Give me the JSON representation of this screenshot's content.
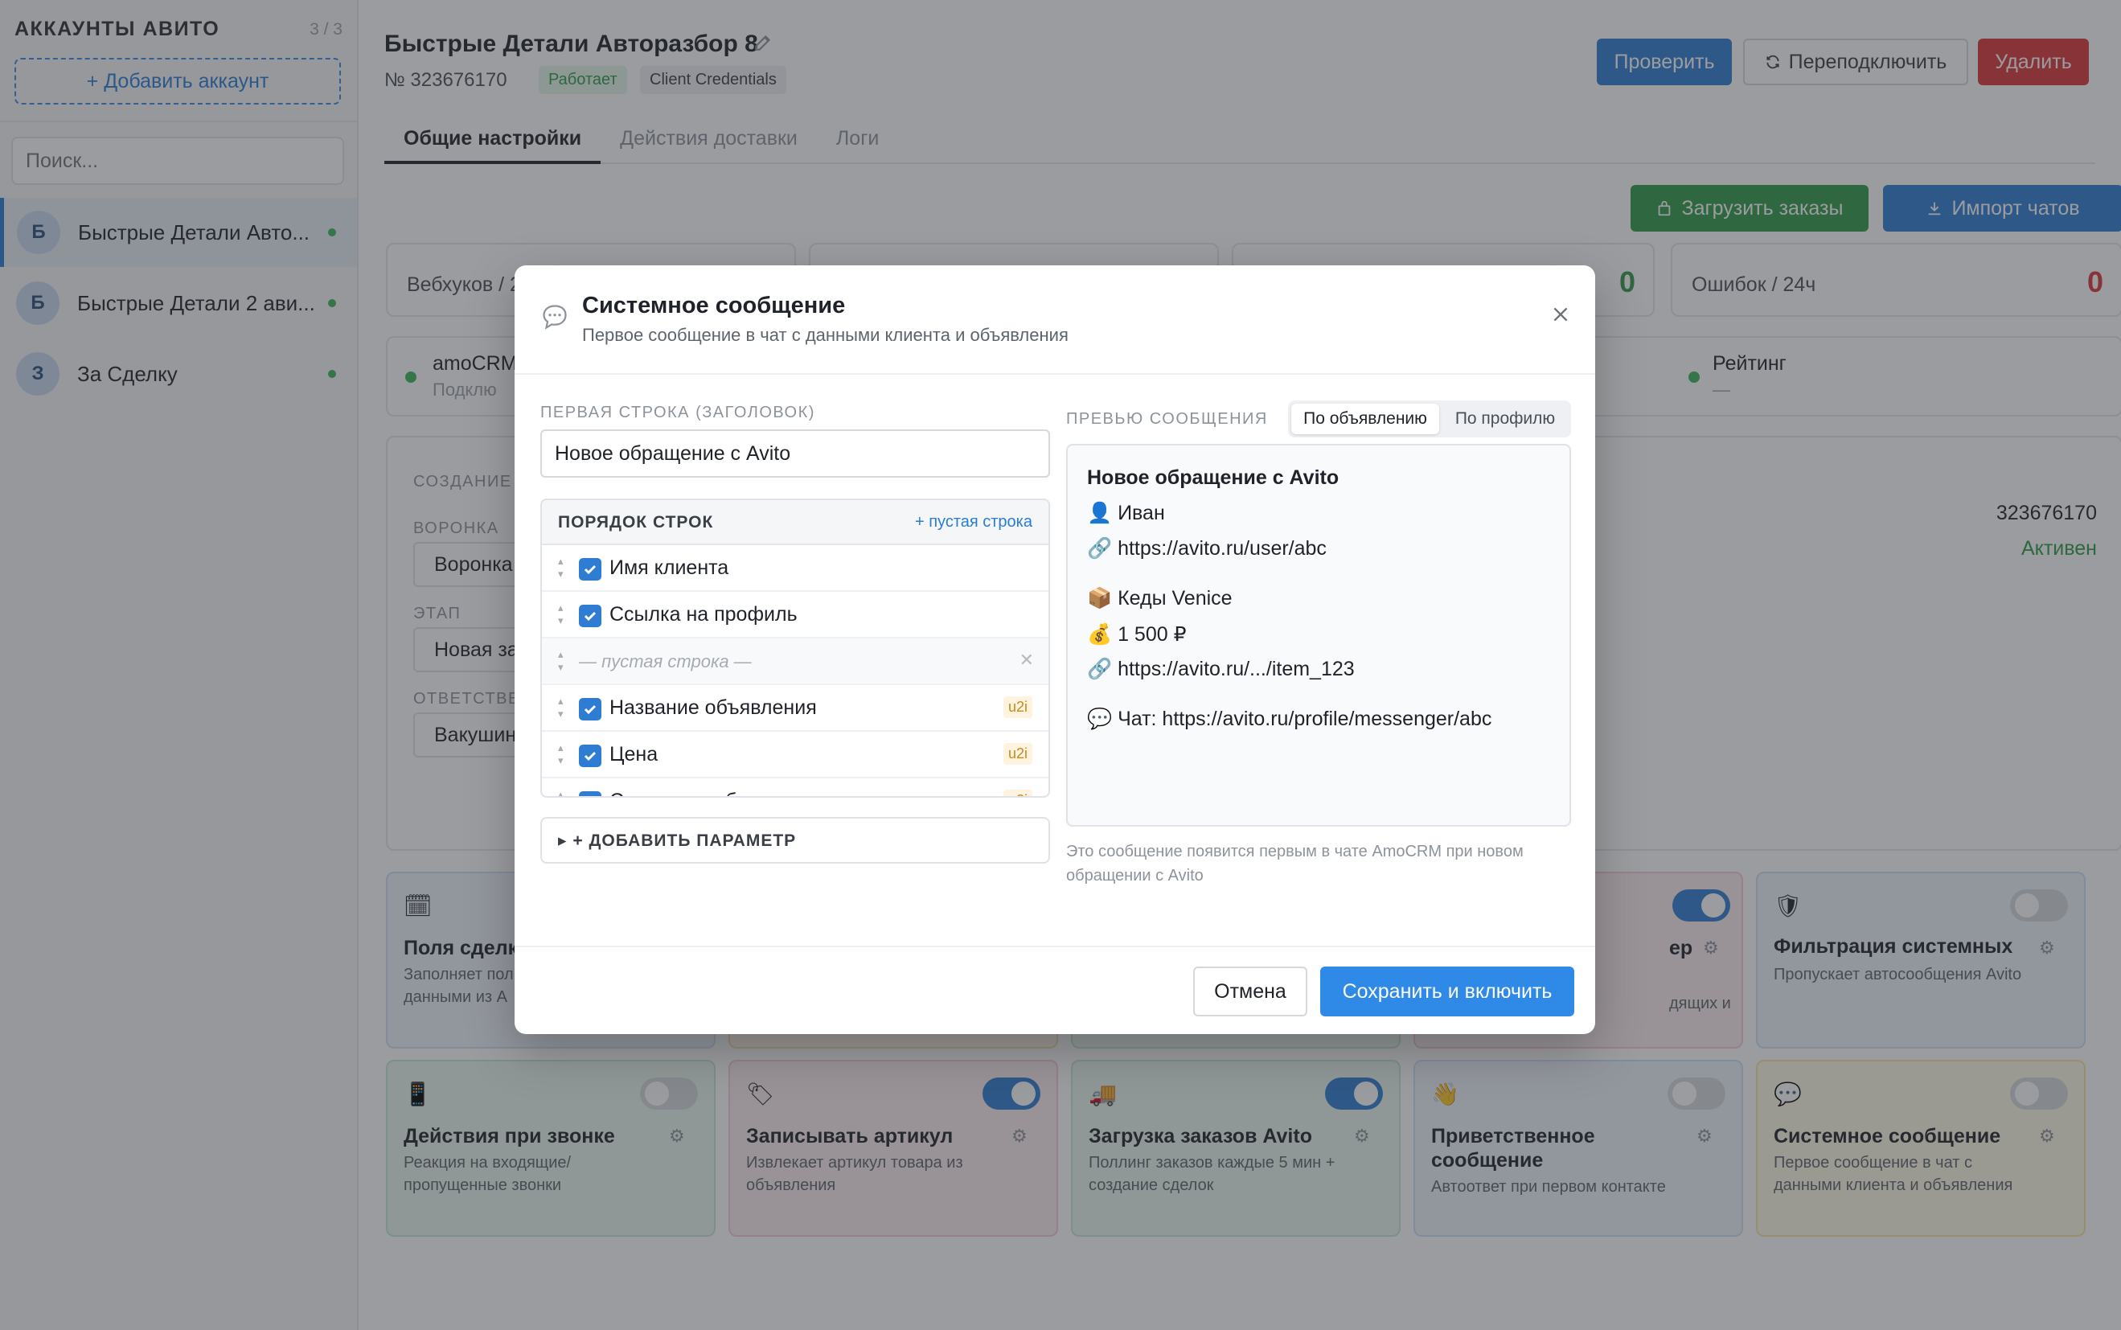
{
  "sidebar": {
    "title": "АККАУНТЫ АВИТО",
    "count": "3 / 3",
    "add_label": "+ Добавить аккаунт",
    "search_placeholder": "Поиск...",
    "accounts": [
      {
        "initial": "Б",
        "name": "Быстрые Детали Авто...",
        "status_color": "#3bb55a"
      },
      {
        "initial": "Б",
        "name": "Быстрые Детали 2 ави...",
        "status_color": "#3bb55a"
      },
      {
        "initial": "З",
        "name": "За Сделку",
        "status_color": "#3bb55a"
      }
    ]
  },
  "header": {
    "title": "Быстрые Детали Авторазбор 8",
    "number": "№ 323676170",
    "status_badge": "Работает",
    "auth_badge": "Client Credentials",
    "check_label": "Проверить",
    "reconnect_label": "Переподключить",
    "delete_label": "Удалить"
  },
  "tabs": [
    "Общие настройки",
    "Действия доставки",
    "Логи"
  ],
  "actions": {
    "load_orders": "Загрузить заказы",
    "import_chats": "Импорт чатов"
  },
  "stats": {
    "webhooks_label": "Вебхуков / 2",
    "third_value": "0",
    "errors_label": "Ошибок / 24ч",
    "errors_value": "0"
  },
  "integrations": {
    "amocrm_title": "amoCRM",
    "amocrm_sub": "Подклю",
    "rating_title": "Рейтинг",
    "rating_sub": "—"
  },
  "deal_section": {
    "caption": "СОЗДАНИЕ",
    "funnel_label": "ВОРОНКА",
    "funnel_value": "Воронка",
    "stage_label": "ЭТАП",
    "stage_value": "Новая за",
    "responsible_label": "ОТВЕТСТВЕН",
    "responsible_value": "Вакушин",
    "account_id": "323676170",
    "account_state": "Активен"
  },
  "features_row1": [
    {
      "icon": "🗓",
      "title": "Поля сделк",
      "desc": "Заполняет пол данными из А"
    },
    {
      "title": "ер",
      "desc": "дящих и"
    },
    {
      "icon": "🛡",
      "title": "Фильтрация системных",
      "desc": "Пропускает автосообщения Avito"
    }
  ],
  "features_row2": [
    {
      "icon": "📱",
      "title": "Действия при звонке",
      "desc": "Реакция на входящие/ пропущенные звонки",
      "enabled": false
    },
    {
      "icon": "🏷",
      "title": "Записывать артикул",
      "desc": "Извлекает артикул товара из объявления",
      "enabled": true
    },
    {
      "icon": "🚚",
      "title": "Загрузка заказов Avito",
      "desc": "Поллинг заказов каждые 5 мин + создание сделок",
      "enabled": true
    },
    {
      "icon": "👋",
      "title": "Приветственное сообщение",
      "desc": "Автоответ при первом контакте",
      "enabled": false
    },
    {
      "icon": "💬",
      "title": "Системное сообщение",
      "desc": "Первое сообщение в чат с данными клиента и объявления",
      "enabled": false
    }
  ],
  "modal": {
    "title": "Системное сообщение",
    "subtitle": "Первое сообщение в чат с данными клиента и объявления",
    "first_line_label": "ПЕРВАЯ СТРОКА (ЗАГОЛОВОК)",
    "first_line_value": "Новое обращение с Avito",
    "order_title": "ПОРЯДОК СТРОК",
    "add_empty_line": "+ пустая строка",
    "empty_line_text": "— пустая строка —",
    "u2i": "u2i",
    "rows": [
      "Имя клиента",
      "Ссылка на профиль",
      "Название объявления",
      "Цена",
      "Ссылка на объявление"
    ],
    "add_param": "▸ + ДОБАВИТЬ ПАРАМЕТР",
    "preview_label": "ПРЕВЬЮ СООБЩЕНИЯ",
    "preview_tabs": [
      "По объявлению",
      "По профилю"
    ],
    "preview": {
      "heading": "Новое обращение с Avito",
      "client": "👤 Иван",
      "profile": "🔗 https://avito.ru/user/abc",
      "item": "📦 Кеды Venice",
      "price": "💰 1 500 ₽",
      "item_link": "🔗 https://avito.ru/.../item_123",
      "chat": "💬 Чат: https://avito.ru/profile/messenger/abc"
    },
    "note": "Это сообщение появится первым в чате AmoCRM при новом обращении с Avito",
    "cancel_label": "Отмена",
    "save_label": "Сохранить и включить"
  },
  "colors": {
    "primary": "#2e7dd2",
    "success": "#2f9a4a",
    "danger": "#d8363a"
  }
}
